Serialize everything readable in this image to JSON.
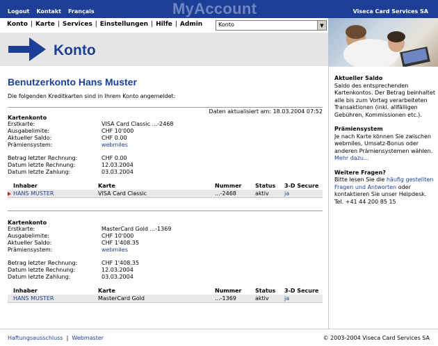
{
  "header": {
    "links": [
      "Logout",
      "Kontakt",
      "Français"
    ],
    "brand": "MyAccount",
    "company": "Viseca Card Services SA"
  },
  "nav": {
    "items": [
      "Konto",
      "Karte",
      "Services",
      "Einstellungen",
      "Hilfe",
      "Admin"
    ],
    "select_value": "Konto"
  },
  "page_title": "Konto",
  "main": {
    "heading": "Benutzerkonto Hans Muster",
    "intro": "Die folgenden Kreditkarten sind in Ihrem Konto angemeldet:",
    "updated": "Daten aktualisiert am: 18.03.2004 07:52",
    "table_headers": [
      "Inhaber",
      "Karte",
      "Nummer",
      "Status",
      "3-D Secure"
    ],
    "accounts": [
      {
        "title": "Kartenkonto",
        "fields1": [
          {
            "k": "Erstkarte:",
            "v": "VISA Card Classic ...-2468"
          },
          {
            "k": "Ausgabelimite:",
            "v": "CHF 10'000"
          },
          {
            "k": "Aktueller Saldo:",
            "v": "CHF 0.00"
          },
          {
            "k": "Prämiensystem:",
            "v": "webmiles"
          }
        ],
        "fields2": [
          {
            "k": "Betrag letzter Rechnung:",
            "v": "CHF 0.00"
          },
          {
            "k": "Datum letzte Rechnung:",
            "v": "12.03.2004"
          },
          {
            "k": "Datum letzte Zahlung:",
            "v": "03.03.2004"
          }
        ],
        "row": {
          "inhaber": "HANS MUSTER",
          "karte": "VISA Card Classic",
          "nummer": "...-2468",
          "status": "aktiv",
          "secure": "ja"
        }
      },
      {
        "title": "Kartenkonto",
        "fields1": [
          {
            "k": "Erstkarte:",
            "v": "MasterCard Gold ...-1369"
          },
          {
            "k": "Ausgabelimite:",
            "v": "CHF 10'000"
          },
          {
            "k": "Aktueller Saldo:",
            "v": "CHF 1'408.35"
          },
          {
            "k": "Prämiensystem:",
            "v": "webmiles"
          }
        ],
        "fields2": [
          {
            "k": "Betrag letzter Rechnung:",
            "v": "CHF 1'408.35"
          },
          {
            "k": "Datum letzte Rechnung:",
            "v": "12.03.2004"
          },
          {
            "k": "Datum letzte Zahlung:",
            "v": "03.03.2004"
          }
        ],
        "row": {
          "inhaber": "HANS MUSTER",
          "karte": "MasterCard Gold",
          "nummer": "...-1369",
          "status": "aktiv",
          "secure": "ja"
        }
      }
    ]
  },
  "sidebar": {
    "saldo_title": "Aktueller Saldo",
    "saldo_text": "Saldo des entsprechenden Kartenkontos. Der Betrag beinhaltet alle bis zum Vortag verarbeiteten Transaktionen (inkl. allfälligen Gebühren, Kommissionen etc.).",
    "praemien_title": "Prämiensystem",
    "praemien_text": "Je nach Karte können Sie zwischen webmiles, Umsatz-Bonus oder anderen Prämiensystemen wählen.",
    "praemien_link": "Mehr dazu...",
    "fragen_title": "Weitere Fragen?",
    "fragen_pre": "Bitte lesen Sie die",
    "fragen_link": "häufig gestellten Fragen und Antworten",
    "fragen_post": "oder kontaktieren Sie unser Helpdesk.",
    "tel": "Tel. +41 44 200 85 15"
  },
  "footer": {
    "haftung": "Haftungsausschluss",
    "webmaster": "Webmaster",
    "copyright": "© 2003-2004 Viseca Card Services SA"
  },
  "colors": {
    "brand_blue": "#1c3f95",
    "marker_red": "#d51e1e"
  }
}
